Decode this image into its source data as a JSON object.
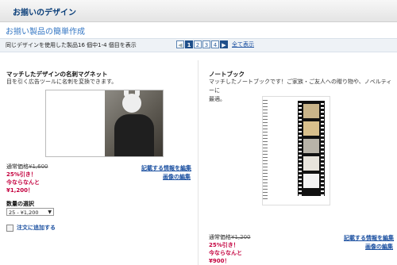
{
  "header": {
    "title": "お揃いのデザイン"
  },
  "subtitle": "お揃い製品の簡単作成",
  "toolbar": {
    "count_text": "同じデザインを使用した製品16 個中1-4 個目を表示",
    "pages": [
      "1",
      "2",
      "3",
      "4"
    ],
    "current_page": "1",
    "show_all": "全て表示"
  },
  "products": [
    {
      "name": "マッチしたデザインの名刺マグネット",
      "description": "目を引く広告ツールに名刺を変換できます。",
      "price_label": "通常価格",
      "price_old": "¥1,600",
      "discount": "25%引き！",
      "now": "今ならなんと",
      "price_new": "¥1,200！",
      "edit_info": "記載する情報を編集",
      "edit_image": "画像の編集",
      "qty_label": "数量の選択",
      "qty_value": "25 - ¥1,200",
      "add_to_cart": "注文に追加する"
    },
    {
      "name": "ノートブック",
      "description_1": "マッチしたノートブックです！ご家族・ご友人への贈り物や、ノベルティーに",
      "description_2": "最適。",
      "price_label": "通常価格",
      "price_old": "¥1,200",
      "discount": "25%引き！",
      "now": "今ならなんと",
      "price_new": "¥900！",
      "edit_info": "記載する情報を編集",
      "edit_image": "画像の編集"
    }
  ],
  "icons": {
    "pager_prev": "chevron-left-icon",
    "pager_next": "chevron-right-icon",
    "select_caret": "chevron-down-icon"
  }
}
